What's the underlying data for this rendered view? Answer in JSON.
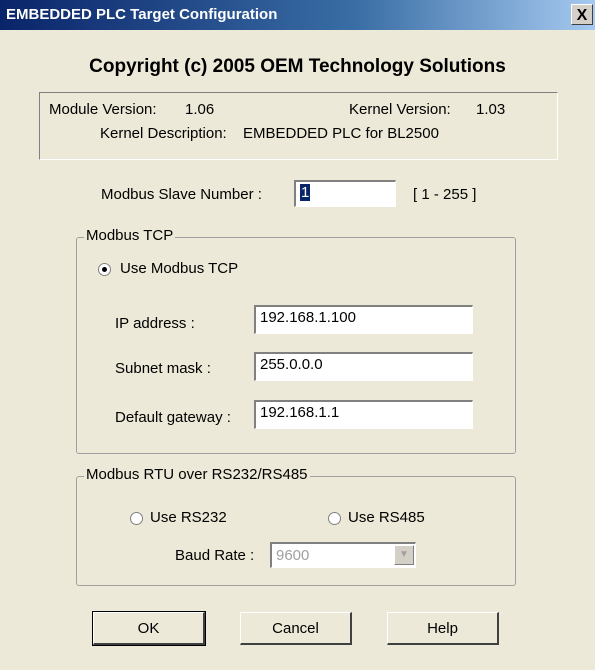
{
  "window": {
    "title": "EMBEDDED PLC Target Configuration",
    "close_glyph": "X"
  },
  "header": {
    "copyright": "Copyright (c) 2005 OEM Technology Solutions"
  },
  "info": {
    "module_version_label": "Module Version:",
    "module_version": "1.06",
    "kernel_version_label": "Kernel Version:",
    "kernel_version": "1.03",
    "kernel_description_label": "Kernel Description:",
    "kernel_description": "EMBEDDED PLC for BL2500"
  },
  "slave": {
    "label": "Modbus Slave Number :",
    "value": "1",
    "range": "[ 1 - 255 ]"
  },
  "modbus_tcp": {
    "group_label": "Modbus TCP",
    "use_label": "Use Modbus TCP",
    "use_selected": true,
    "ip_label": "IP address :",
    "ip_value": "192.168.1.100",
    "subnet_label": "Subnet mask :",
    "subnet_value": "255.0.0.0",
    "gateway_label": "Default gateway :",
    "gateway_value": "192.168.1.1"
  },
  "modbus_rtu": {
    "group_label": "Modbus RTU over RS232/RS485",
    "rs232_label": "Use RS232",
    "rs485_label": "Use RS485",
    "baud_label": "Baud Rate :",
    "baud_value": "9600"
  },
  "buttons": {
    "ok": "OK",
    "cancel": "Cancel",
    "help": "Help"
  },
  "icons": {
    "dropdown": "chevron-down-icon",
    "close": "close-icon"
  }
}
